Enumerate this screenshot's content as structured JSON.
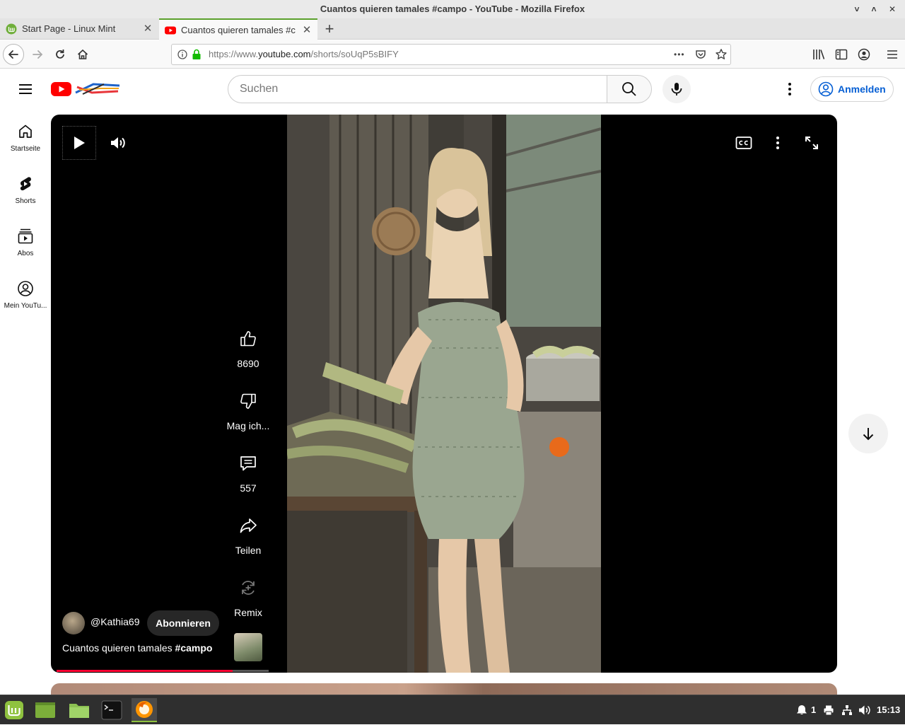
{
  "window": {
    "title": "Cuantos quieren tamales #campo - YouTube - Mozilla Firefox",
    "minimize": "˅",
    "restore": "˄",
    "close": "✕"
  },
  "tabs": [
    {
      "label": "Start Page - Linux Mint",
      "close": "✕"
    },
    {
      "label": "Cuantos quieren tamales #c",
      "close": "✕"
    }
  ],
  "new_tab": "+",
  "url": {
    "prefix": "https://www.",
    "domain": "youtube.com",
    "path": "/shorts/soUqP5sBIFY",
    "page_actions": "•••"
  },
  "youtube": {
    "search_placeholder": "Suchen",
    "sign_in": "Anmelden",
    "guide": [
      {
        "label": "Startseite",
        "icon": "home-icon"
      },
      {
        "label": "Shorts",
        "icon": "shorts-icon"
      },
      {
        "label": "Abos",
        "icon": "subscriptions-icon"
      },
      {
        "label": "Mein YouTu...",
        "icon": "account-circle-icon"
      }
    ],
    "short": {
      "likes": "8690",
      "dislike_label": "Mag ich...",
      "comments": "557",
      "share_label": "Teilen",
      "remix_label": "Remix",
      "channel": "@Kathia69",
      "subscribe": "Abonnieren",
      "caption_text": "Cuantos quieren tamales ",
      "caption_hashtag": "#campo",
      "progress": 0.83
    }
  },
  "taskbar": {
    "notifications": "1",
    "clock": "15:13"
  },
  "colors": {
    "youtube_red": "#ff0000",
    "progress_red": "#ff0033",
    "link_blue": "#065fd4",
    "mint_green": "#8fc23f"
  }
}
